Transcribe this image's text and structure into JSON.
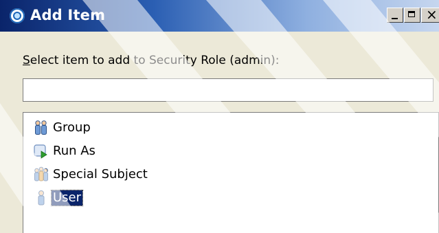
{
  "window": {
    "title": "Add Item",
    "controls": {
      "minimize_icon": "minimize-icon",
      "maximize_icon": "maximize-icon",
      "close_icon": "close-icon"
    }
  },
  "prompt": {
    "mnemonic": "S",
    "rest": "elect item to add to Security Role (admin):"
  },
  "search": {
    "value": "",
    "placeholder": ""
  },
  "items": [
    {
      "label": "Group",
      "icon": "group-icon",
      "selected": false
    },
    {
      "label": "Run As",
      "icon": "run-as-icon",
      "selected": false
    },
    {
      "label": "Special Subject",
      "icon": "special-subject-icon",
      "selected": false
    },
    {
      "label": "User",
      "icon": "user-icon",
      "selected": true
    }
  ],
  "colors": {
    "titlebar_start": "#0a246a",
    "selection": "#0a246a",
    "dialog_bg": "#ece9d8"
  }
}
